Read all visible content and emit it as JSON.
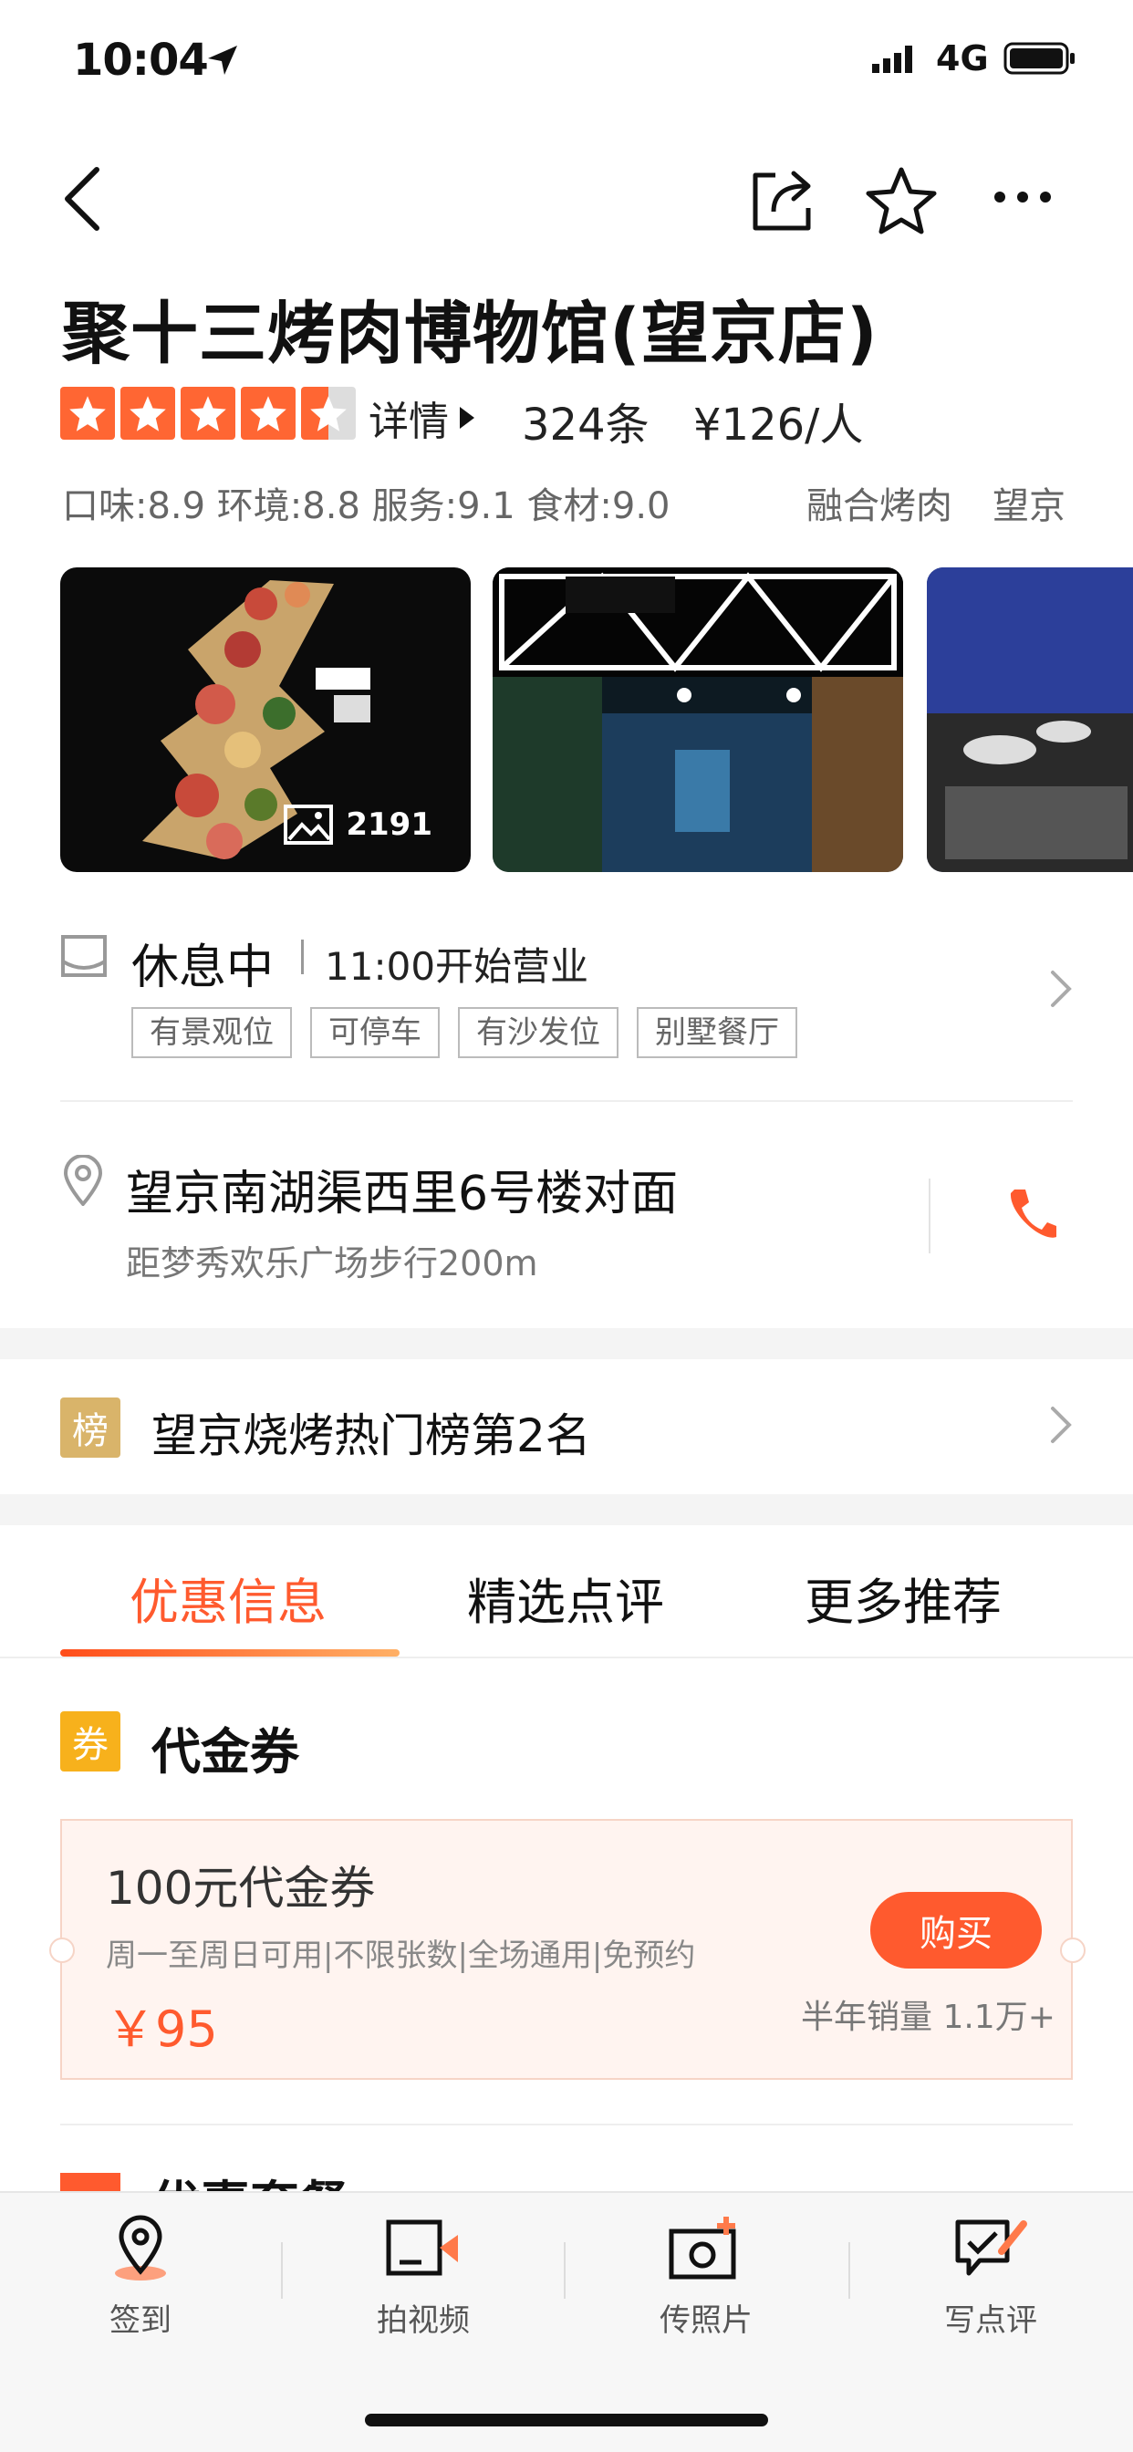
{
  "status_bar": {
    "time": "10:04",
    "network": "4G"
  },
  "header": {
    "back_icon": "chevron-left-icon",
    "share_icon": "share-icon",
    "favorite_icon": "star-outline-icon",
    "more_icon": "more-dots-icon"
  },
  "shop": {
    "name": "聚十三烤肉博物馆(望京店)",
    "rating": 4.5,
    "detail_label": "详情",
    "review_count": "324条",
    "price_per_person": "¥126/人",
    "scores": "口味:8.9 环境:8.8 服务:9.1 食材:9.0",
    "category": "融合烤肉",
    "area": "望京",
    "photo_count": "2191"
  },
  "hours": {
    "status": "休息中",
    "opening": "11:00开始营业",
    "tags": [
      "有景观位",
      "可停车",
      "有沙发位",
      "别墅餐厅"
    ]
  },
  "address": {
    "line": "望京南湖渠西里6号楼对面",
    "distance": "距梦秀欢乐广场步行200m"
  },
  "ranking": {
    "badge": "榜",
    "text": "望京烧烤热门榜第2名"
  },
  "tabs": [
    {
      "label": "优惠信息",
      "active": true
    },
    {
      "label": "精选点评",
      "active": false
    },
    {
      "label": "更多推荐",
      "active": false
    }
  ],
  "voucher_section": {
    "badge": "券",
    "heading": "代金券",
    "coupon": {
      "title": "100元代金券",
      "terms": "周一至周日可用|不限张数|全场通用|免预约",
      "price": "￥95",
      "buy_label": "购买",
      "sales": "半年销量 1.1万+"
    }
  },
  "next_section": {
    "title": "优惠套餐"
  },
  "bottom_actions": [
    {
      "label": "签到",
      "icon": "location-pin-icon"
    },
    {
      "label": "拍视频",
      "icon": "video-camera-icon"
    },
    {
      "label": "传照片",
      "icon": "camera-plus-icon"
    },
    {
      "label": "写点评",
      "icon": "write-review-icon"
    }
  ],
  "colors": {
    "accent": "#ff5a2e",
    "star": "#ff6633",
    "rank_badge": "#d9b46a",
    "voucher_badge": "#f7b11c"
  }
}
